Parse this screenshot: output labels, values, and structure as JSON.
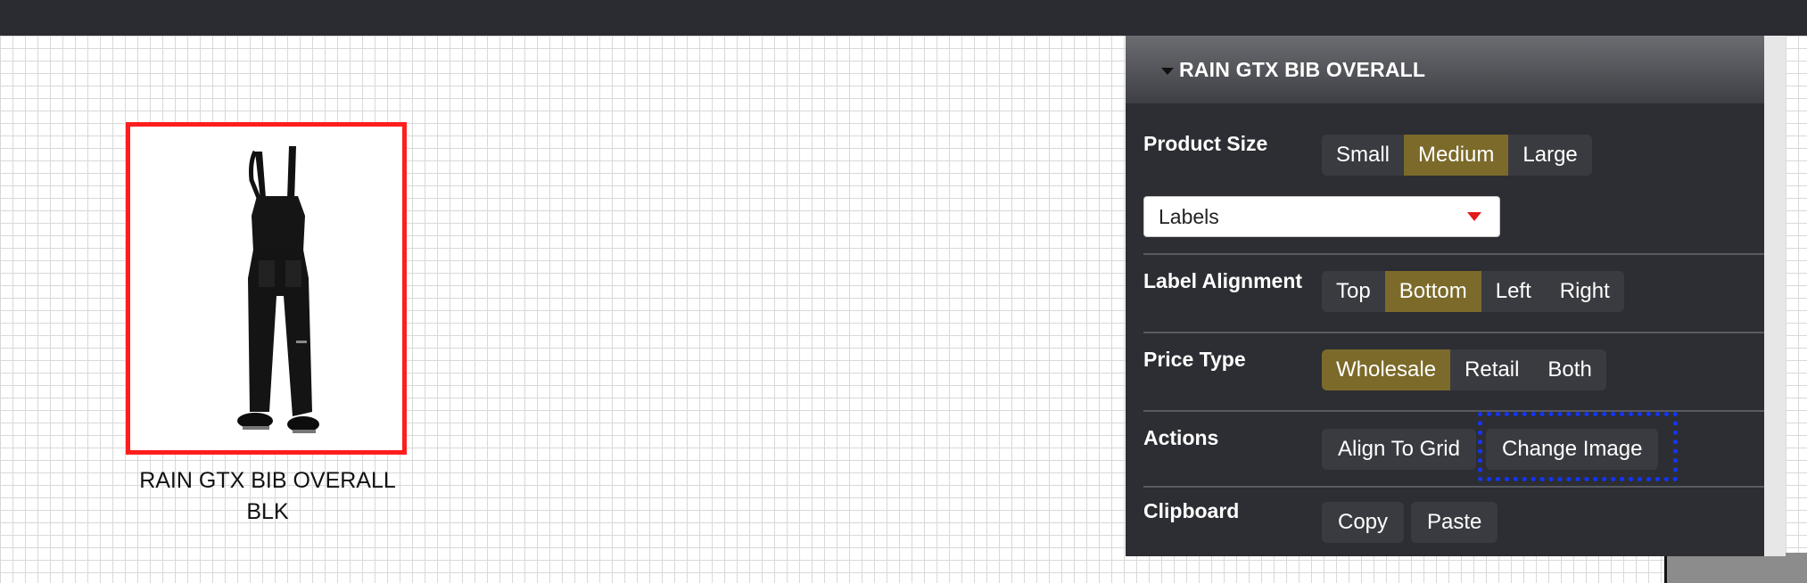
{
  "product": {
    "label_line1": "RAIN GTX BIB OVERALL",
    "label_line2": "BLK"
  },
  "panel": {
    "title": "RAIN GTX BIB OVERALL",
    "product_size": {
      "label": "Product Size",
      "options": [
        "Small",
        "Medium",
        "Large"
      ],
      "selected": "Medium"
    },
    "labels_select": {
      "value": "Labels"
    },
    "label_alignment": {
      "label": "Label Alignment",
      "options": [
        "Top",
        "Bottom",
        "Left",
        "Right"
      ],
      "selected": "Bottom"
    },
    "price_type": {
      "label": "Price Type",
      "options": [
        "Wholesale",
        "Retail",
        "Both"
      ],
      "selected": "Wholesale"
    },
    "actions": {
      "label": "Actions",
      "align_to_grid": "Align To Grid",
      "change_image": "Change Image"
    },
    "clipboard": {
      "label": "Clipboard",
      "copy": "Copy",
      "paste": "Paste"
    }
  },
  "colors": {
    "active_segment": "#7b6a2a",
    "selection_border": "#ff1e1e",
    "focus_highlight": "#1235ff",
    "panel_background": "#2d2e33"
  }
}
